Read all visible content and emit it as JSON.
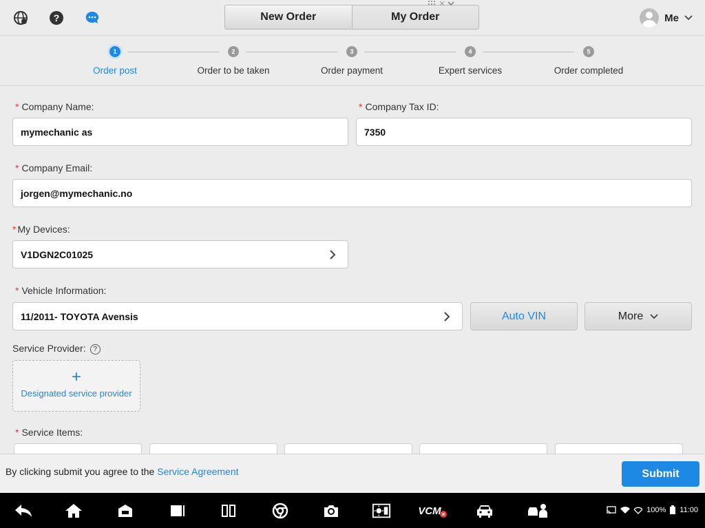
{
  "header": {
    "tabs": [
      {
        "label": "New Order",
        "active": true
      },
      {
        "label": "My Order",
        "active": false
      }
    ],
    "user_name": "Me",
    "icons": [
      "globe-icon",
      "help-icon",
      "chat-icon"
    ]
  },
  "stepper": {
    "steps": [
      {
        "num": "1",
        "label": "Order post",
        "active": true
      },
      {
        "num": "2",
        "label": "Order to be taken",
        "active": false
      },
      {
        "num": "3",
        "label": "Order payment",
        "active": false
      },
      {
        "num": "4",
        "label": "Expert services",
        "active": false
      },
      {
        "num": "5",
        "label": "Order completed",
        "active": false
      }
    ]
  },
  "form": {
    "required_mark": "*",
    "company_name": {
      "label": "Company Name:",
      "value": "mymechanic as"
    },
    "company_tax_id": {
      "label": "Company Tax ID:",
      "value": "7350"
    },
    "company_email": {
      "label": "Company Email:",
      "value": "jorgen@mymechanic.no"
    },
    "my_devices": {
      "label": "My Devices:",
      "value": "V1DGN2C01025"
    },
    "vehicle_info": {
      "label": "Vehicle Information:",
      "value": "11/2011- TOYOTA Avensis"
    },
    "auto_vin_label": "Auto VIN",
    "more_label": "More",
    "service_provider": {
      "label": "Service Provider:",
      "help": "?",
      "plus": "+",
      "add_text": "Designated service provider"
    },
    "service_items_label": "Service Items:"
  },
  "footer": {
    "agree_text": "By clicking submit you agree to the",
    "agreement_link": "Service Agreement",
    "submit_label": "Submit"
  },
  "status_bar": {
    "battery": "100%",
    "time": "11:00",
    "vcm_label": "VCM"
  },
  "colors": {
    "accent": "#1e88e5",
    "required": "#e53935",
    "background": "#ececec"
  }
}
